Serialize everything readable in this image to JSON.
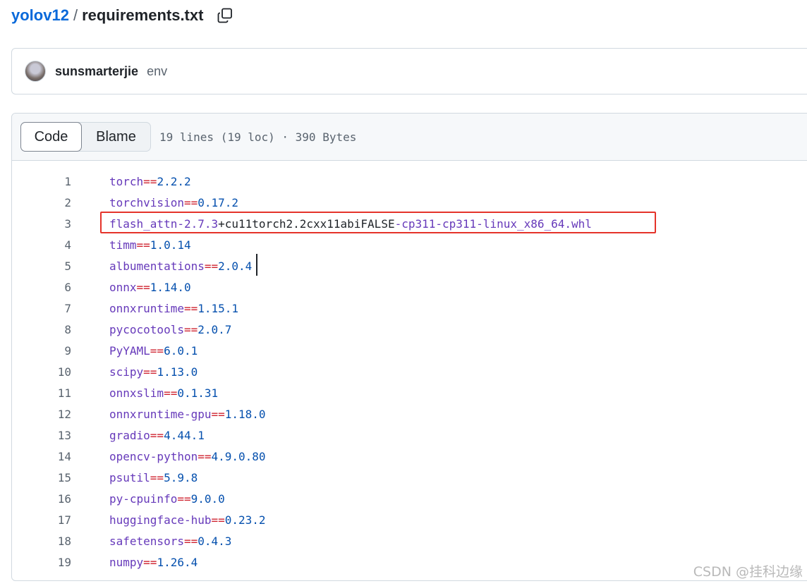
{
  "breadcrumb": {
    "repo": "yolov12",
    "separator": "/",
    "file": "requirements.txt"
  },
  "icons": {
    "copy": "copy-icon"
  },
  "commit": {
    "author": "sunsmarterjie",
    "message": "env"
  },
  "file_header": {
    "tab_code": "Code",
    "tab_blame": "Blame",
    "info": "19 lines (19 loc) · 390 Bytes"
  },
  "lines": [
    {
      "num": "1",
      "pkg": "torch",
      "op": "==",
      "ver": "2.2.2"
    },
    {
      "num": "2",
      "pkg": "torchvision",
      "op": "==",
      "ver": "0.17.2"
    },
    {
      "num": "3",
      "pkg": "flash_attn-2.7.3",
      "plain": "+cu11torch2.2cxx11abiFALSE",
      "rest": "-cp311-cp311-linux_x86_64.whl"
    },
    {
      "num": "4",
      "pkg": "timm",
      "op": "==",
      "ver": "1.0.14"
    },
    {
      "num": "5",
      "pkg": "albumentations",
      "op": "==",
      "ver": "2.0.4"
    },
    {
      "num": "6",
      "pkg": "onnx",
      "op": "==",
      "ver": "1.14.0"
    },
    {
      "num": "7",
      "pkg": "onnxruntime",
      "op": "==",
      "ver": "1.15.1"
    },
    {
      "num": "8",
      "pkg": "pycocotools",
      "op": "==",
      "ver": "2.0.7"
    },
    {
      "num": "9",
      "pkg": "PyYAML",
      "op": "==",
      "ver": "6.0.1"
    },
    {
      "num": "10",
      "pkg": "scipy",
      "op": "==",
      "ver": "1.13.0"
    },
    {
      "num": "11",
      "pkg": "onnxslim",
      "op": "==",
      "ver": "0.1.31"
    },
    {
      "num": "12",
      "pkg": "onnxruntime-gpu",
      "op": "==",
      "ver": "1.18.0"
    },
    {
      "num": "13",
      "pkg": "gradio",
      "op": "==",
      "ver": "4.44.1"
    },
    {
      "num": "14",
      "pkg": "opencv-python",
      "op": "==",
      "ver": "4.9.0.80"
    },
    {
      "num": "15",
      "pkg": "psutil",
      "op": "==",
      "ver": "5.9.8"
    },
    {
      "num": "16",
      "pkg": "py-cpuinfo",
      "op": "==",
      "ver": "9.0.0"
    },
    {
      "num": "17",
      "pkg": "huggingface-hub",
      "op": "==",
      "ver": "0.23.2"
    },
    {
      "num": "18",
      "pkg": "safetensors",
      "op": "==",
      "ver": "0.4.3"
    },
    {
      "num": "19",
      "pkg": "numpy",
      "op": "==",
      "ver": "1.26.4"
    }
  ],
  "watermark": "CSDN @挂科边缘",
  "colors": {
    "link": "#0969da",
    "package": "#6639ba",
    "operator": "#cf222e",
    "version": "#0550ae",
    "highlight_border": "#e5332a"
  }
}
